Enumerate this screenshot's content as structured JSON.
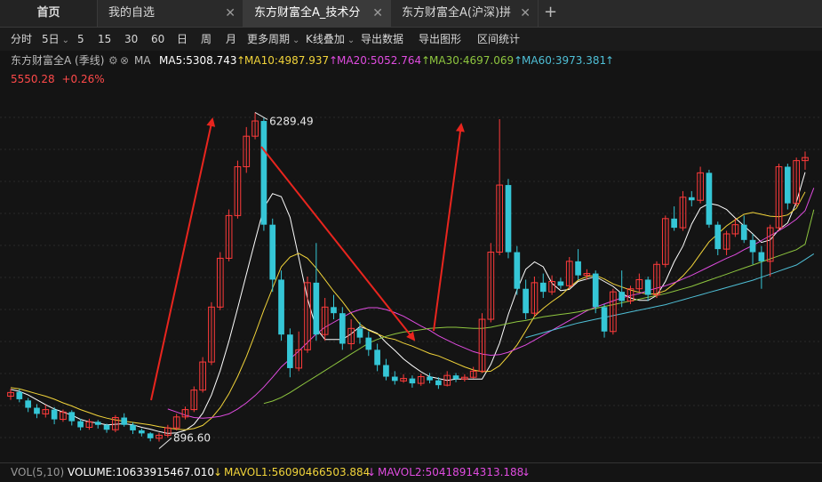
{
  "tabs": {
    "home": "首页",
    "watchlist": "我的自选",
    "active": "东方财富全A_技术分",
    "other": "东方财富全A(沪深)拼",
    "close": "✕",
    "add": "+"
  },
  "toolbar": {
    "items": [
      "分时",
      "5日",
      "5",
      "15",
      "30",
      "60",
      "日",
      "周",
      "月",
      "更多周期",
      "K线叠加",
      "导出数据",
      "导出图形",
      "区间统计"
    ]
  },
  "legend": {
    "name": "东方财富全A (季线)",
    "ma_label": "MA",
    "ma5": "MA5:5308.743",
    "ma10": "MA10:4987.937",
    "ma20": "MA20:5052.764",
    "ma30": "MA30:4697.069",
    "ma60": "MA60:3973.381",
    "arrow": "↑"
  },
  "price": {
    "last": "5550.28",
    "change": "+0.26%"
  },
  "volume_bar": {
    "label": "VOL(5,10)",
    "volume": "VOLUME:10633915467.010",
    "mavol1": "MAVOL1:56090466503.884",
    "mavol2": "MAVOL2:50418914313.188",
    "down": "↓"
  },
  "colors": {
    "up": "#ff3b3b",
    "down": "#35c6d6",
    "ma5": "#ffffff",
    "ma10": "#f2d43a",
    "ma20": "#e04ce0",
    "ma30": "#8ec63f",
    "ma60": "#4fbfd6",
    "arrow": "#e8251e"
  },
  "chart_data": {
    "type": "candlestick",
    "period": "quarterly",
    "annotations": {
      "high_label": "6289.49",
      "low_label": "896.60"
    },
    "candles": [
      {
        "open": 1640,
        "close": 1700,
        "high": 1760,
        "low": 1580
      },
      {
        "open": 1710,
        "close": 1590,
        "high": 1760,
        "low": 1540
      },
      {
        "open": 1570,
        "close": 1450,
        "high": 1610,
        "low": 1380
      },
      {
        "open": 1450,
        "close": 1350,
        "high": 1510,
        "low": 1280
      },
      {
        "open": 1350,
        "close": 1420,
        "high": 1500,
        "low": 1290
      },
      {
        "open": 1420,
        "close": 1260,
        "high": 1460,
        "low": 1180
      },
      {
        "open": 1260,
        "close": 1380,
        "high": 1420,
        "low": 1220
      },
      {
        "open": 1380,
        "close": 1230,
        "high": 1410,
        "low": 1160
      },
      {
        "open": 1230,
        "close": 1130,
        "high": 1270,
        "low": 1080
      },
      {
        "open": 1130,
        "close": 1220,
        "high": 1270,
        "low": 1090
      },
      {
        "open": 1220,
        "close": 1170,
        "high": 1250,
        "low": 1110
      },
      {
        "open": 1170,
        "close": 1090,
        "high": 1190,
        "low": 1040
      },
      {
        "open": 1090,
        "close": 1290,
        "high": 1330,
        "low": 1050
      },
      {
        "open": 1290,
        "close": 1170,
        "high": 1360,
        "low": 1140
      },
      {
        "open": 1170,
        "close": 1080,
        "high": 1210,
        "low": 1020
      },
      {
        "open": 1080,
        "close": 1030,
        "high": 1110,
        "low": 980
      },
      {
        "open": 1030,
        "close": 950,
        "high": 1050,
        "low": 900
      },
      {
        "open": 950,
        "close": 1000,
        "high": 1040,
        "low": 896
      },
      {
        "open": 1000,
        "close": 1120,
        "high": 1170,
        "low": 960
      },
      {
        "open": 1120,
        "close": 1300,
        "high": 1350,
        "low": 1080
      },
      {
        "open": 1300,
        "close": 1420,
        "high": 1470,
        "low": 1260
      },
      {
        "open": 1420,
        "close": 1740,
        "high": 1800,
        "low": 1380
      },
      {
        "open": 1740,
        "close": 2200,
        "high": 2280,
        "low": 1700
      },
      {
        "open": 2200,
        "close": 3100,
        "high": 3180,
        "low": 2150
      },
      {
        "open": 3100,
        "close": 3900,
        "high": 4000,
        "low": 3050
      },
      {
        "open": 3900,
        "close": 4600,
        "high": 4700,
        "low": 3850
      },
      {
        "open": 4600,
        "close": 5400,
        "high": 5500,
        "low": 4550
      },
      {
        "open": 5400,
        "close": 5900,
        "high": 6050,
        "low": 5300
      },
      {
        "open": 5900,
        "close": 6150,
        "high": 6289.49,
        "low": 5850
      },
      {
        "open": 6150,
        "close": 4450,
        "high": 6200,
        "low": 4350
      },
      {
        "open": 4450,
        "close": 3550,
        "high": 4550,
        "low": 3350
      },
      {
        "open": 3550,
        "close": 2650,
        "high": 3700,
        "low": 2550
      },
      {
        "open": 2650,
        "close": 2100,
        "high": 2750,
        "low": 1950
      },
      {
        "open": 2100,
        "close": 2400,
        "high": 2700,
        "low": 2050
      },
      {
        "open": 2400,
        "close": 3500,
        "high": 3600,
        "low": 2350
      },
      {
        "open": 3500,
        "close": 2650,
        "high": 4150,
        "low": 2550
      },
      {
        "open": 2650,
        "close": 3100,
        "high": 3250,
        "low": 2550
      },
      {
        "open": 3100,
        "close": 3000,
        "high": 3300,
        "low": 2900
      },
      {
        "open": 3000,
        "close": 2500,
        "high": 3100,
        "low": 2400
      },
      {
        "open": 2500,
        "close": 2750,
        "high": 2900,
        "low": 2400
      },
      {
        "open": 2750,
        "close": 2600,
        "high": 2850,
        "low": 2500
      },
      {
        "open": 2600,
        "close": 2400,
        "high": 2700,
        "low": 2300
      },
      {
        "open": 2400,
        "close": 2150,
        "high": 2500,
        "low": 2050
      },
      {
        "open": 2150,
        "close": 1960,
        "high": 2250,
        "low": 1900
      },
      {
        "open": 1960,
        "close": 1890,
        "high": 2050,
        "low": 1830
      },
      {
        "open": 1890,
        "close": 1930,
        "high": 2000,
        "low": 1860
      },
      {
        "open": 1930,
        "close": 1850,
        "high": 1980,
        "low": 1780
      },
      {
        "open": 1850,
        "close": 1960,
        "high": 2010,
        "low": 1810
      },
      {
        "open": 1960,
        "close": 1900,
        "high": 2020,
        "low": 1850
      },
      {
        "open": 1900,
        "close": 1820,
        "high": 1950,
        "low": 1760
      },
      {
        "open": 1820,
        "close": 1980,
        "high": 2050,
        "low": 1800
      },
      {
        "open": 1980,
        "close": 1920,
        "high": 2020,
        "low": 1870
      },
      {
        "open": 1920,
        "close": 1950,
        "high": 2000,
        "low": 1880
      },
      {
        "open": 1950,
        "close": 2050,
        "high": 2120,
        "low": 1930
      },
      {
        "open": 2050,
        "close": 2900,
        "high": 3000,
        "low": 2020
      },
      {
        "open": 2900,
        "close": 4000,
        "high": 4150,
        "low": 2850
      },
      {
        "open": 4000,
        "close": 5100,
        "high": 6180,
        "low": 3950
      },
      {
        "open": 5100,
        "close": 4000,
        "high": 5200,
        "low": 3900
      },
      {
        "open": 4000,
        "close": 3400,
        "high": 4100,
        "low": 3300
      },
      {
        "open": 3400,
        "close": 3000,
        "high": 3550,
        "low": 2900
      },
      {
        "open": 3000,
        "close": 3500,
        "high": 3600,
        "low": 2950
      },
      {
        "open": 3500,
        "close": 3350,
        "high": 3650,
        "low": 3250
      },
      {
        "open": 3350,
        "close": 3520,
        "high": 3620,
        "low": 3300
      },
      {
        "open": 3520,
        "close": 3450,
        "high": 3580,
        "low": 3400
      },
      {
        "open": 3450,
        "close": 3850,
        "high": 3920,
        "low": 3400
      },
      {
        "open": 3850,
        "close": 3620,
        "high": 4050,
        "low": 3550
      },
      {
        "open": 3620,
        "close": 3650,
        "high": 3720,
        "low": 3550
      },
      {
        "open": 3650,
        "close": 3100,
        "high": 3700,
        "low": 3000
      },
      {
        "open": 3100,
        "close": 2700,
        "high": 3150,
        "low": 2600
      },
      {
        "open": 2700,
        "close": 3350,
        "high": 3400,
        "low": 2650
      },
      {
        "open": 3350,
        "close": 3200,
        "high": 3700,
        "low": 3100
      },
      {
        "open": 3200,
        "close": 3400,
        "high": 3450,
        "low": 3150
      },
      {
        "open": 3400,
        "close": 3550,
        "high": 3650,
        "low": 3350
      },
      {
        "open": 3550,
        "close": 3300,
        "high": 3600,
        "low": 3200
      },
      {
        "open": 3300,
        "close": 3800,
        "high": 3850,
        "low": 3250
      },
      {
        "open": 3800,
        "close": 4550,
        "high": 4600,
        "low": 3750
      },
      {
        "open": 4550,
        "close": 4400,
        "high": 4750,
        "low": 4350
      },
      {
        "open": 4400,
        "close": 4900,
        "high": 5000,
        "low": 4350
      },
      {
        "open": 4900,
        "close": 4850,
        "high": 5000,
        "low": 4750
      },
      {
        "open": 4850,
        "close": 5300,
        "high": 5400,
        "low": 4800
      },
      {
        "open": 5300,
        "close": 4450,
        "high": 5350,
        "low": 4400
      },
      {
        "open": 4450,
        "close": 4050,
        "high": 4500,
        "low": 3950
      },
      {
        "open": 4050,
        "close": 4300,
        "high": 4350,
        "low": 3950
      },
      {
        "open": 4300,
        "close": 4450,
        "high": 4550,
        "low": 4250
      },
      {
        "open": 4450,
        "close": 4200,
        "high": 4600,
        "low": 4150
      },
      {
        "open": 4200,
        "close": 4000,
        "high": 4300,
        "low": 3800
      },
      {
        "open": 4000,
        "close": 3850,
        "high": 4100,
        "low": 3400
      },
      {
        "open": 3850,
        "close": 4400,
        "high": 4450,
        "low": 3600
      },
      {
        "open": 4400,
        "close": 5400,
        "high": 5450,
        "low": 4350
      },
      {
        "open": 5400,
        "close": 4800,
        "high": 5450,
        "low": 4700
      },
      {
        "open": 4800,
        "close": 5500,
        "high": 5550,
        "low": 4750
      },
      {
        "open": 5500,
        "close": 5550.28,
        "high": 5650,
        "low": 5350
      }
    ],
    "ma_lines": {
      "ma5": [
        1750,
        1720,
        1660,
        1580,
        1500,
        1430,
        1380,
        1330,
        1260,
        1220,
        1200,
        1170,
        1180,
        1190,
        1170,
        1130,
        1100,
        1060,
        1030,
        1040,
        1080,
        1180,
        1360,
        1660,
        2060,
        2540,
        3080,
        3640,
        4190,
        4730,
        4960,
        4910,
        4570,
        3910,
        3240,
        2750,
        2570,
        2570,
        2570,
        2660,
        2780,
        2730,
        2670,
        2520,
        2390,
        2250,
        2140,
        2040,
        1960,
        1930,
        1900,
        1920,
        1920,
        1920,
        1920,
        2160,
        2510,
        2980,
        3380,
        3720,
        3840,
        3760,
        3490,
        3370,
        3390,
        3520,
        3560,
        3600,
        3520,
        3440,
        3320,
        3250,
        3210,
        3210,
        3290,
        3520,
        3840,
        4100,
        4460,
        4720,
        4800,
        4770,
        4700,
        4560,
        4430,
        4300,
        4160,
        4200,
        4370,
        4480,
        4820,
        5308.743
      ],
      "ma10": [
        1780,
        1760,
        1720,
        1680,
        1640,
        1590,
        1530,
        1480,
        1420,
        1370,
        1320,
        1280,
        1250,
        1230,
        1210,
        1190,
        1170,
        1140,
        1120,
        1100,
        1090,
        1110,
        1160,
        1280,
        1450,
        1680,
        1960,
        2290,
        2660,
        3050,
        3410,
        3760,
        3920,
        3980,
        3900,
        3740,
        3550,
        3360,
        3190,
        3000,
        2820,
        2720,
        2660,
        2600,
        2570,
        2510,
        2460,
        2400,
        2340,
        2300,
        2240,
        2180,
        2120,
        2070,
        2040,
        2050,
        2140,
        2300,
        2480,
        2710,
        2950,
        3080,
        3190,
        3290,
        3420,
        3540,
        3600,
        3620,
        3560,
        3480,
        3430,
        3380,
        3340,
        3310,
        3320,
        3370,
        3480,
        3610,
        3770,
        3970,
        4170,
        4300,
        4430,
        4530,
        4620,
        4650,
        4620,
        4590,
        4580,
        4610,
        4720,
        4987.937
      ],
      "ma20": [
        null,
        null,
        null,
        null,
        null,
        null,
        null,
        null,
        null,
        null,
        null,
        null,
        null,
        null,
        null,
        null,
        null,
        null,
        1430,
        1380,
        1330,
        1290,
        1280,
        1290,
        1310,
        1350,
        1430,
        1530,
        1650,
        1790,
        1950,
        2120,
        2250,
        2380,
        2520,
        2660,
        2770,
        2850,
        2930,
        3010,
        3060,
        3090,
        3090,
        3060,
        3010,
        2950,
        2870,
        2790,
        2720,
        2630,
        2560,
        2490,
        2430,
        2370,
        2330,
        2310,
        2320,
        2360,
        2420,
        2480,
        2560,
        2640,
        2720,
        2800,
        2880,
        2960,
        3040,
        3100,
        3150,
        3200,
        3250,
        3290,
        3320,
        3370,
        3410,
        3450,
        3500,
        3560,
        3620,
        3690,
        3760,
        3830,
        3900,
        3960,
        4040,
        4110,
        4190,
        4270,
        4350,
        4440,
        4540,
        4680,
        5052.764
      ],
      "ma30": [
        null,
        null,
        null,
        null,
        null,
        null,
        null,
        null,
        null,
        null,
        null,
        null,
        null,
        null,
        null,
        null,
        null,
        null,
        null,
        null,
        null,
        null,
        null,
        null,
        null,
        null,
        null,
        null,
        null,
        1520,
        1560,
        1620,
        1700,
        1790,
        1880,
        1970,
        2060,
        2150,
        2240,
        2330,
        2420,
        2510,
        2570,
        2620,
        2660,
        2690,
        2710,
        2730,
        2750,
        2760,
        2770,
        2770,
        2760,
        2750,
        2750,
        2770,
        2800,
        2830,
        2860,
        2880,
        2910,
        2940,
        2960,
        2980,
        3000,
        3020,
        3050,
        3080,
        3110,
        3140,
        3170,
        3200,
        3230,
        3260,
        3290,
        3320,
        3360,
        3400,
        3440,
        3490,
        3540,
        3590,
        3640,
        3690,
        3740,
        3790,
        3840,
        3890,
        3940,
        3990,
        4040,
        4130,
        4697.069
      ],
      "ma60": [
        null,
        null,
        null,
        null,
        null,
        null,
        null,
        null,
        null,
        null,
        null,
        null,
        null,
        null,
        null,
        null,
        null,
        null,
        null,
        null,
        null,
        null,
        null,
        null,
        null,
        null,
        null,
        null,
        null,
        null,
        null,
        null,
        null,
        null,
        null,
        null,
        null,
        null,
        null,
        null,
        null,
        null,
        null,
        null,
        null,
        null,
        null,
        null,
        null,
        null,
        null,
        null,
        null,
        null,
        null,
        null,
        null,
        null,
        null,
        2600,
        2640,
        2680,
        2720,
        2760,
        2800,
        2840,
        2870,
        2900,
        2930,
        2960,
        2990,
        3020,
        3050,
        3080,
        3110,
        3140,
        3180,
        3220,
        3260,
        3300,
        3340,
        3380,
        3420,
        3460,
        3500,
        3540,
        3590,
        3640,
        3690,
        3740,
        3790,
        3880,
        3973.381
      ]
    }
  }
}
